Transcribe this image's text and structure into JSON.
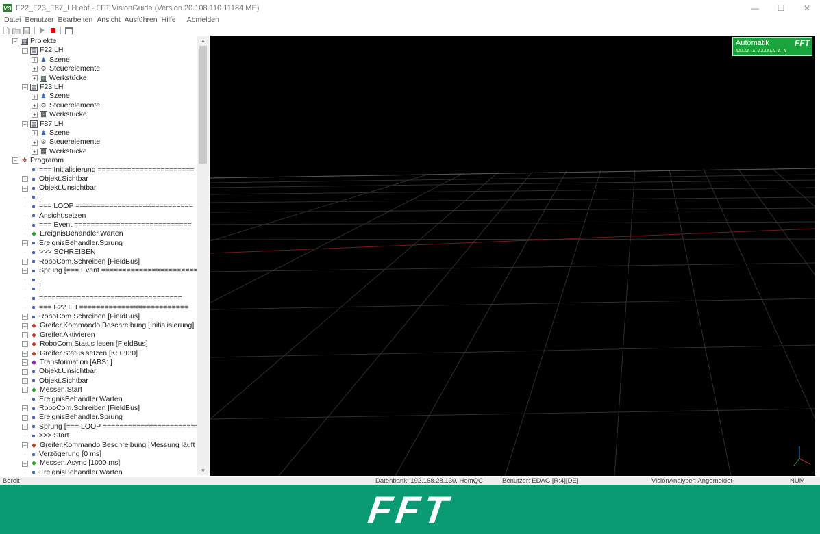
{
  "window": {
    "title": "F22_F23_F87_LH.ebf - FFT VisionGuide (Version 20.108.110.11184 ME)",
    "app_icon": "VG",
    "minimize": "—",
    "maximize": "☐",
    "close": "✕"
  },
  "menu": {
    "items": [
      "Datei",
      "Benutzer",
      "Bearbeiten",
      "Ansicht",
      "Ausführen",
      "Hilfe"
    ],
    "logout": "Abmelden"
  },
  "tree": {
    "items": [
      {
        "text": "Projekte",
        "indent": 0,
        "expander": "minus",
        "icon": "projects-icon"
      },
      {
        "text": "F22 LH",
        "indent": 1,
        "expander": "minus",
        "icon": "project-icon"
      },
      {
        "text": "Szene",
        "indent": 2,
        "expander": "plus",
        "icon": "scene-icon"
      },
      {
        "text": "Steuerelemente",
        "indent": 2,
        "expander": "plus",
        "icon": "controls-icon"
      },
      {
        "text": "Werkstücke",
        "indent": 2,
        "expander": "plus",
        "icon": "workpieces-icon"
      },
      {
        "text": "F23 LH",
        "indent": 1,
        "expander": "minus",
        "icon": "project-icon"
      },
      {
        "text": "Szene",
        "indent": 2,
        "expander": "plus",
        "icon": "scene-icon"
      },
      {
        "text": "Steuerelemente",
        "indent": 2,
        "expander": "plus",
        "icon": "controls-icon"
      },
      {
        "text": "Werkstücke",
        "indent": 2,
        "expander": "plus",
        "icon": "workpieces-icon"
      },
      {
        "text": "F87 LH",
        "indent": 1,
        "expander": "minus",
        "icon": "project-icon"
      },
      {
        "text": "Szene",
        "indent": 2,
        "expander": "plus",
        "icon": "scene-icon"
      },
      {
        "text": "Steuerelemente",
        "indent": 2,
        "expander": "plus",
        "icon": "controls-icon"
      },
      {
        "text": "Werkstücke",
        "indent": 2,
        "expander": "plus",
        "icon": "workpieces-icon"
      },
      {
        "text": "Programm",
        "indent": 0,
        "expander": "minus",
        "icon": "program-icon"
      },
      {
        "text": "=== Initialisierung =======================",
        "indent": 1,
        "expander": "none",
        "icon": "dot"
      },
      {
        "text": "Objekt.Sichtbar",
        "indent": 1,
        "expander": "plus",
        "icon": "dot"
      },
      {
        "text": "Objekt.Unsichtbar",
        "indent": 1,
        "expander": "plus",
        "icon": "dot"
      },
      {
        "text": "!",
        "indent": 1,
        "expander": "none",
        "icon": "dot"
      },
      {
        "text": "=== LOOP ============================",
        "indent": 1,
        "expander": "none",
        "icon": "dot"
      },
      {
        "text": "Ansicht.setzen",
        "indent": 1,
        "expander": "none",
        "icon": "dot"
      },
      {
        "text": "=== Event ============================",
        "indent": 1,
        "expander": "none",
        "icon": "dot"
      },
      {
        "text": "EreignisBehandler.Warten",
        "indent": 1,
        "expander": "none",
        "icon": "green-icon"
      },
      {
        "text": "EreignisBehandler.Sprung",
        "indent": 1,
        "expander": "plus",
        "icon": "dot"
      },
      {
        "text": ">>> SCHREIBEN",
        "indent": 1,
        "expander": "none",
        "icon": "dot"
      },
      {
        "text": "RoboCom.Schreiben [FieldBus]",
        "indent": 1,
        "expander": "plus",
        "icon": "dot"
      },
      {
        "text": "Sprung [=== Event =========================",
        "indent": 1,
        "expander": "plus",
        "icon": "dot"
      },
      {
        "text": "!",
        "indent": 1,
        "expander": "none",
        "icon": "dot"
      },
      {
        "text": "!",
        "indent": 1,
        "expander": "none",
        "icon": "dot"
      },
      {
        "text": "==================================",
        "indent": 1,
        "expander": "none",
        "icon": "dot"
      },
      {
        "text": "=== F22 LH ==========================",
        "indent": 1,
        "expander": "none",
        "icon": "dot"
      },
      {
        "text": "RoboCom.Schreiben [FieldBus]",
        "indent": 1,
        "expander": "plus",
        "icon": "dot"
      },
      {
        "text": "Greifer.Kommando Beschreibung [Initialisierung]",
        "indent": 1,
        "expander": "plus",
        "icon": "red-icon"
      },
      {
        "text": "Greifer.Aktivieren",
        "indent": 1,
        "expander": "plus",
        "icon": "red-icon"
      },
      {
        "text": "RoboCom.Status lesen [FieldBus]",
        "indent": 1,
        "expander": "plus",
        "icon": "red-icon"
      },
      {
        "text": "Greifer.Status setzen [K: 0:0:0]",
        "indent": 1,
        "expander": "plus",
        "icon": "red-icon"
      },
      {
        "text": "Transformation [ABS: ]",
        "indent": 1,
        "expander": "plus",
        "icon": "multi-icon"
      },
      {
        "text": "Objekt.Unsichtbar",
        "indent": 1,
        "expander": "plus",
        "icon": "dot"
      },
      {
        "text": "Objekt.Sichtbar",
        "indent": 1,
        "expander": "plus",
        "icon": "dot"
      },
      {
        "text": "Messen.Start",
        "indent": 1,
        "expander": "plus",
        "icon": "green-icon"
      },
      {
        "text": "EreignisBehandler.Warten",
        "indent": 1,
        "expander": "none",
        "icon": "dot"
      },
      {
        "text": "RoboCom.Schreiben [FieldBus]",
        "indent": 1,
        "expander": "plus",
        "icon": "dot"
      },
      {
        "text": "EreignisBehandler.Sprung",
        "indent": 1,
        "expander": "plus",
        "icon": "dot"
      },
      {
        "text": "Sprung [=== LOOP =========================",
        "indent": 1,
        "expander": "plus",
        "icon": "dot"
      },
      {
        "text": ">>> Start",
        "indent": 1,
        "expander": "none",
        "icon": "dot"
      },
      {
        "text": "Greifer.Kommando Beschreibung [Messung läuft ...]",
        "indent": 1,
        "expander": "plus",
        "icon": "red-icon"
      },
      {
        "text": "Verzögerung [0 ms]",
        "indent": 1,
        "expander": "none",
        "icon": "dot"
      },
      {
        "text": "Messen.Async [1000 ms]",
        "indent": 1,
        "expander": "plus",
        "icon": "green-icon"
      },
      {
        "text": "EreignisBehandler.Warten",
        "indent": 1,
        "expander": "none",
        "icon": "dot"
      }
    ]
  },
  "viewport": {
    "mode_label": "Automatik",
    "brand": "FFT",
    "indicator_text": "ΔΔΔΔΔ'Δ ΔΔΔΔΔΔ Δ'Δ"
  },
  "status": {
    "ready": "Bereit",
    "database": "Datenbank: 192.168.28.130, HemQC",
    "user": "Benutzer:  EDAG [R:4][DE]",
    "analyser": "VisionAnalyser: Angemeldet",
    "num": "NUM"
  },
  "footer": {
    "logo": "FFT"
  },
  "colors": {
    "footer": "#0a9b73",
    "badge": "#19a53b",
    "viewport": "#000000"
  }
}
